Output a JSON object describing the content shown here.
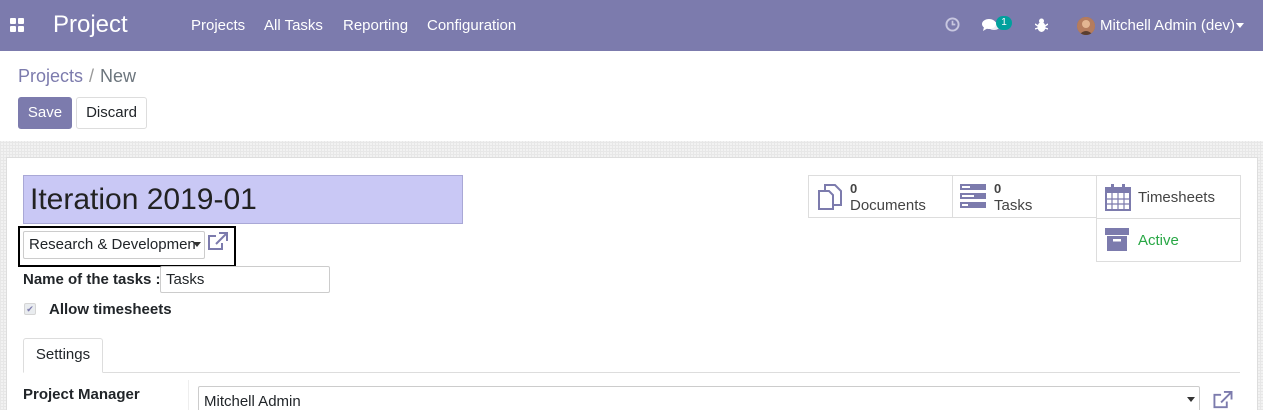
{
  "navbar": {
    "app_title": "Project",
    "menu": [
      "Projects",
      "All Tasks",
      "Reporting",
      "Configuration"
    ],
    "messages_count": "1",
    "user_name": "Mitchell Admin (dev)",
    "icons": [
      "apps-grid-icon",
      "clock-icon",
      "chat-icon",
      "bug-icon",
      "avatar"
    ],
    "color": "#7c7bad"
  },
  "breadcrumb": {
    "parent": "Projects",
    "separator": "/",
    "current": "New"
  },
  "buttons": {
    "save": "Save",
    "discard": "Discard"
  },
  "form": {
    "project_name": "Iteration 2019-01",
    "analytic_account": "Research & Developmen",
    "tasks_label": "Name of the tasks :",
    "tasks_value": "Tasks",
    "allow_timesheets_label": "Allow timesheets",
    "allow_timesheets_checked": true,
    "tab_settings": "Settings",
    "project_manager_label": "Project Manager",
    "project_manager_value": "Mitchell Admin"
  },
  "smart_buttons": {
    "documents": {
      "count": "0",
      "label": "Documents"
    },
    "tasks": {
      "count": "0",
      "label": "Tasks"
    },
    "timesheets": {
      "label": "Timesheets"
    },
    "active": {
      "label": "Active",
      "color": "#28a745"
    }
  }
}
